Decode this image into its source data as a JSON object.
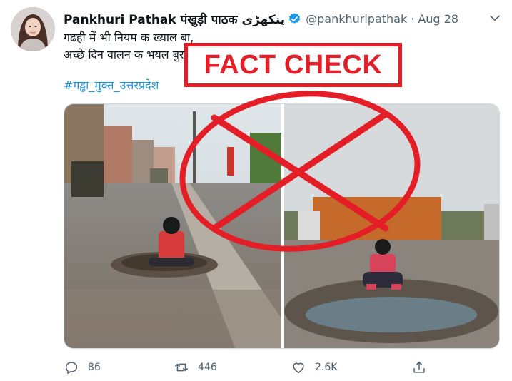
{
  "tweet": {
    "display_name": "Pankhuri Pathak पंखुड़ी पाठक پنکھڑی",
    "handle": "@pankhuripathak",
    "separator": "·",
    "date": "Aug 28",
    "text_lines": [
      "गढही में भी नियम क ख्याल बा,",
      "अच्छे दिन वालन क भयल बुरा हाल बा।"
    ],
    "hashtag": "#गड्ढा_मुक्त_उत्तरप्रदेश"
  },
  "overlay": {
    "label": "FACT CHECK",
    "color": "#e41e26"
  },
  "actions": {
    "reply_count": "86",
    "retweet_count": "446",
    "like_count": "2.6K"
  },
  "icons": [
    "verified-badge-icon",
    "chevron-down-icon",
    "reply-icon",
    "retweet-icon",
    "like-icon",
    "share-icon"
  ],
  "colors": {
    "link": "#1b95e0",
    "secondary": "#536471",
    "verified": "#1d9bf0"
  }
}
